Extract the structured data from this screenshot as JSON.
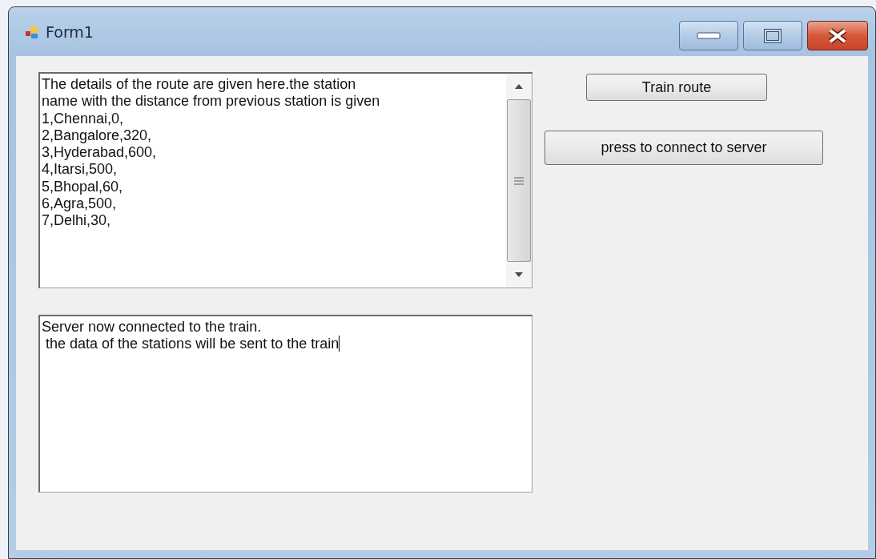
{
  "window": {
    "title": "Form1"
  },
  "route_box": {
    "lines": [
      "The details of the route are given here.the station",
      "name with the distance from previous station is given",
      "1,Chennai,0,",
      "2,Bangalore,320,",
      "3,Hyderabad,600,",
      "4,Itarsi,500,",
      "5,Bhopal,60,",
      "6,Agra,500,",
      "7,Delhi,30,"
    ]
  },
  "server_box": {
    "lines": [
      "Server now connected to the train.",
      " the data of the stations will be sent to the train"
    ],
    "focused": true
  },
  "buttons": [
    {
      "label": "Train route",
      "kind": "small"
    },
    {
      "label": "press to connect to server",
      "kind": "wide"
    }
  ]
}
